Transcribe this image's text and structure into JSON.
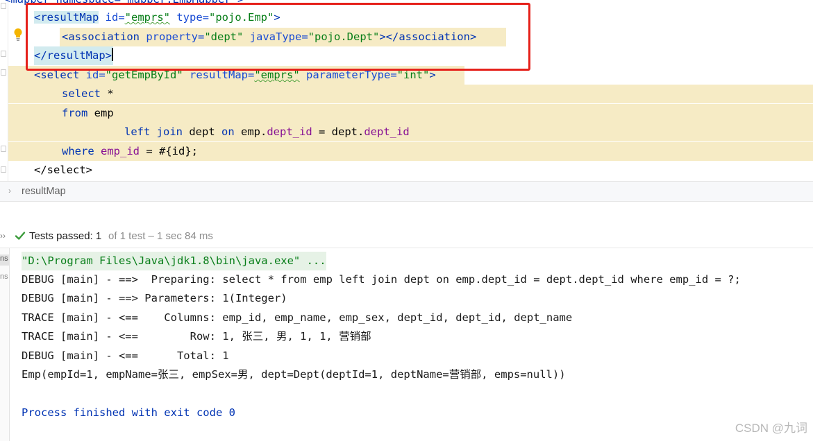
{
  "editor": {
    "top_cut": "<mapper namespace=\"mapper.EmpMapper\">",
    "result_map": {
      "open_tag": "<resultMap",
      "id_attr": "id=",
      "id_val": "\"emprs\"",
      "type_attr": "type=",
      "type_val": "\"pojo.Emp\"",
      "open_end": ">",
      "assoc_open": "<association",
      "prop_attr": "property=",
      "prop_val": "\"dept\"",
      "jt_attr": "javaType=",
      "jt_val": "\"pojo.Dept\"",
      "assoc_close": "></association>",
      "close_tag": "</resultMap",
      "close_end": ">"
    },
    "select_stmt": {
      "open_tag": "<select",
      "id_attr": "id=",
      "id_val": "\"getEmpById\"",
      "rm_attr": "resultMap=",
      "rm_val": "\"emprs\"",
      "pt_attr": "parameterType=",
      "pt_val": "\"int\"",
      "open_end": ">",
      "kw_select": "select",
      "star": " *",
      "kw_from": "from",
      "from_tbl": " emp",
      "kw_left": "left",
      "kw_join": "join",
      "join_tbl": " dept ",
      "kw_on": "on",
      "on_a": " emp.",
      "on_a_fld": "dept_id",
      "on_eq": " = dept.",
      "on_b_fld": "dept_id",
      "kw_where": "where",
      "where_fld": "emp_id",
      "where_rest": " = #{id};",
      "close_tag": "</select>"
    }
  },
  "breadcrumb": {
    "chevron": "›",
    "item": "resultMap"
  },
  "testbar": {
    "arrows": "››",
    "status": "Tests passed:",
    "count": "1",
    "detail": "of 1 test – 1 sec 84 ms"
  },
  "console": {
    "side_tab_1": "ns",
    "side_tab_2": "ns",
    "lines": [
      "\"D:\\Program Files\\Java\\jdk1.8\\bin\\java.exe\" ...",
      "DEBUG [main] - ==>  Preparing: select * from emp left join dept on emp.dept_id = dept.dept_id where emp_id = ?;",
      "DEBUG [main] - ==> Parameters: 1(Integer)",
      "TRACE [main] - <==    Columns: emp_id, emp_name, emp_sex, dept_id, dept_id, dept_name",
      "TRACE [main] - <==        Row: 1, 张三, 男, 1, 1, 营销部",
      "DEBUG [main] - <==      Total: 1",
      "Emp(empId=1, empName=张三, empSex=男, dept=Dept(deptId=1, deptName=营销部, emps=null))",
      "Process finished with exit code 0"
    ]
  },
  "watermark": "CSDN @九词",
  "colors": {
    "tag": "#0033b3",
    "attr": "#174ad4",
    "value": "#067d17",
    "field": "#871094",
    "highlight": "#f6ebc5",
    "tag_highlight": "#d2ebef",
    "red_box": "#e5201a",
    "pass_green": "#3a9b3a"
  }
}
